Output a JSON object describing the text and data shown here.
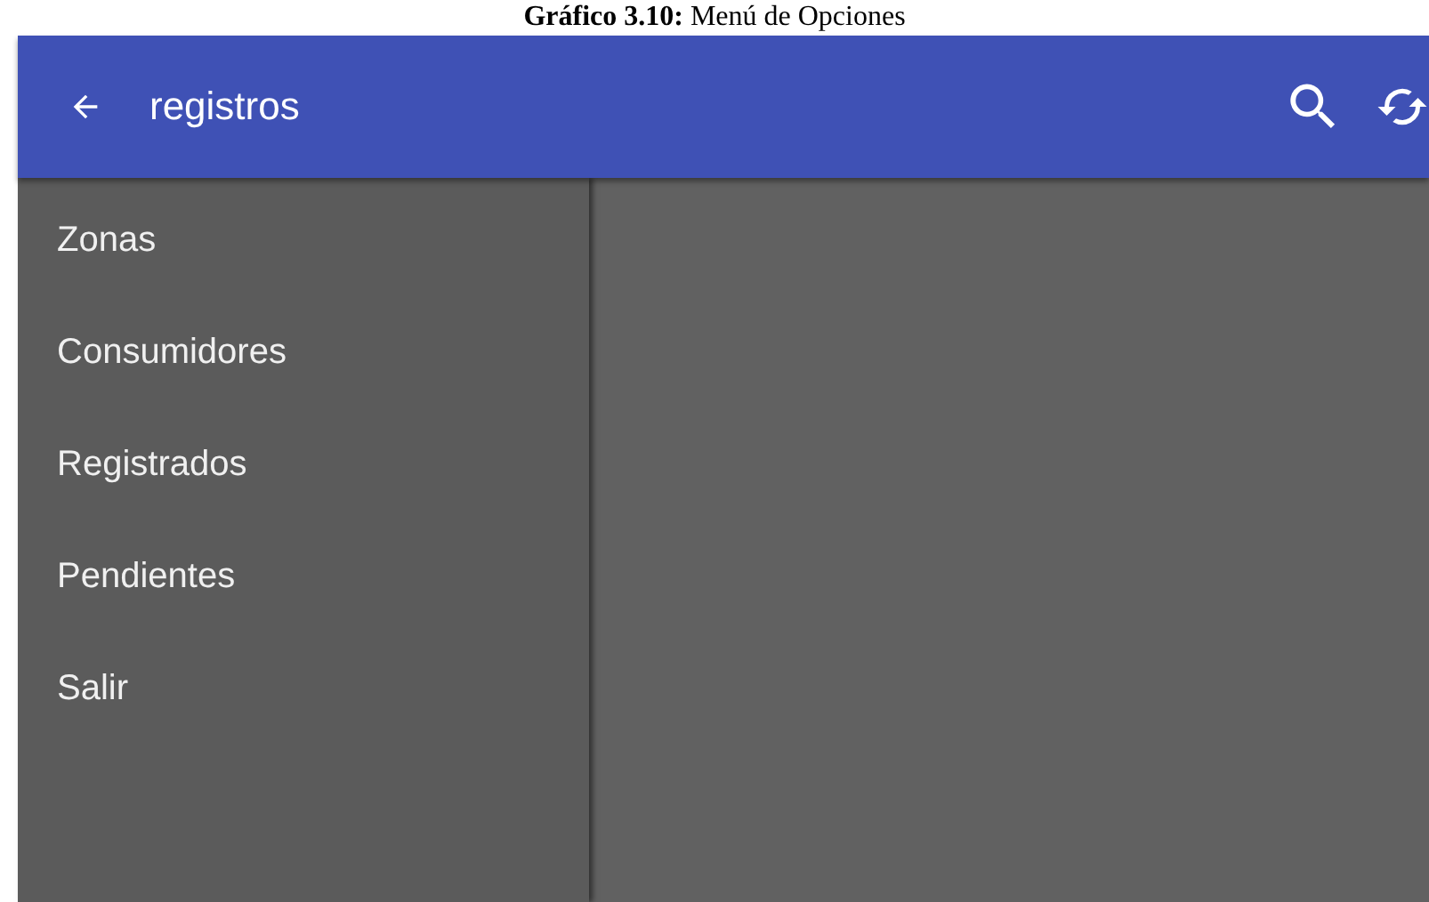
{
  "caption": "**Gráfico 3.10:** Menú de Opciones",
  "app_bar": {
    "title": "registros"
  },
  "menu": {
    "items": [
      {
        "label": "Zonas"
      },
      {
        "label": "Consumidores"
      },
      {
        "label": "Registrados"
      },
      {
        "label": "Pendientes"
      },
      {
        "label": "Salir"
      }
    ]
  }
}
